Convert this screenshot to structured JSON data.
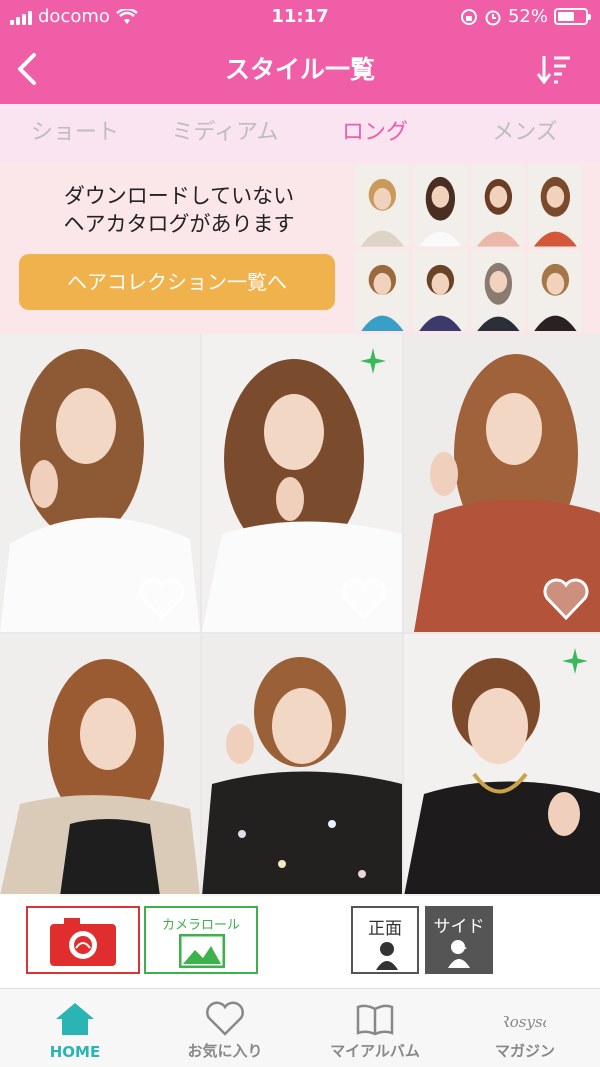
{
  "status": {
    "carrier": "docomo",
    "time": "11:17",
    "battery": "52%"
  },
  "header": {
    "title": "スタイル一覧"
  },
  "tabs": [
    {
      "label": "ショート",
      "active": false
    },
    {
      "label": "ミディアム",
      "active": false
    },
    {
      "label": "ロング",
      "active": true
    },
    {
      "label": "メンズ",
      "active": false
    }
  ],
  "banner": {
    "line1": "ダウンロードしていない",
    "line2": "ヘアカタログがあります",
    "button": "ヘアコレクション一覧へ"
  },
  "photos": [
    {
      "name": "long-style-1",
      "new": false
    },
    {
      "name": "long-style-2",
      "new": true
    },
    {
      "name": "long-style-3",
      "new": false
    },
    {
      "name": "long-style-4",
      "new": false
    },
    {
      "name": "long-style-5",
      "new": false
    },
    {
      "name": "long-style-6",
      "new": true
    }
  ],
  "tools": {
    "camera_roll": "カメラロール",
    "front": "正面",
    "side": "サイド"
  },
  "bottom_nav": [
    {
      "label": "HOME",
      "icon": "home-icon"
    },
    {
      "label": "お気に入り",
      "icon": "heart-icon"
    },
    {
      "label": "マイアルバム",
      "icon": "book-icon"
    },
    {
      "label": "マガジン",
      "icon": "rosysa-logo"
    }
  ],
  "colors": {
    "brand": "#f05ea8",
    "accent_tab": "#ee5fa9",
    "button": "#f0b24c",
    "home": "#2bb4b4"
  }
}
